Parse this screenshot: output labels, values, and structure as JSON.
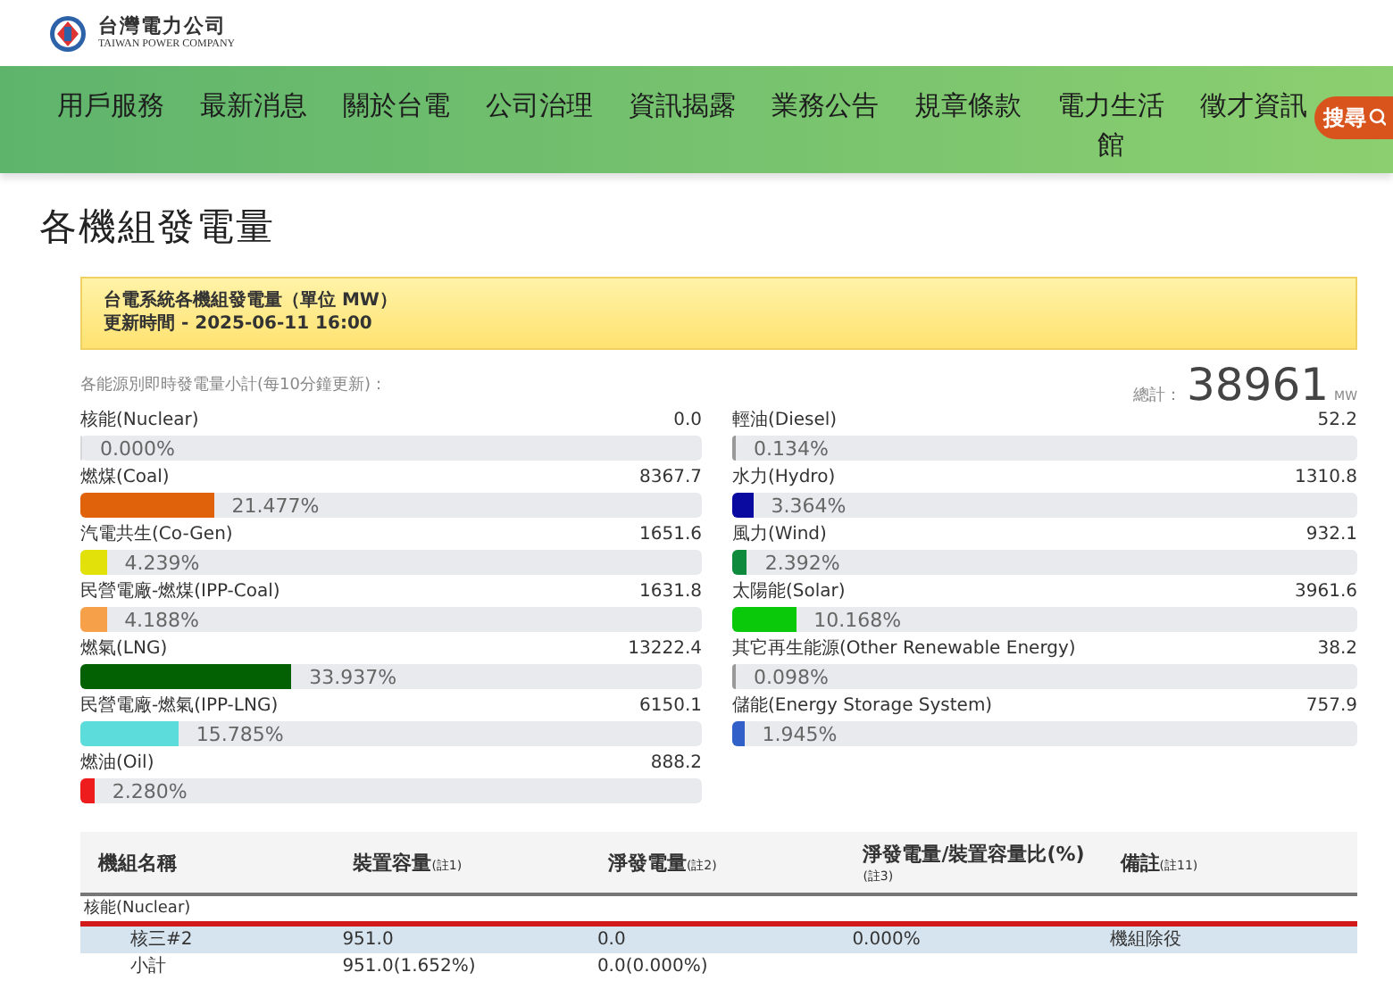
{
  "header": {
    "logo_title": "台灣電力公司",
    "logo_subtitle": "TAIWAN POWER COMPANY"
  },
  "nav": {
    "items": [
      "用戶服務",
      "最新消息",
      "關於台電",
      "公司治理",
      "資訊揭露",
      "業務公告",
      "規章條款",
      "電力生活館",
      "徵才資訊"
    ],
    "search_label": "搜尋"
  },
  "page_title": "各機組發電量",
  "notice": {
    "line1": "台電系統各機組發電量（單位 MW）",
    "line2": "更新時間 - 2025-06-11 16:00"
  },
  "summary": {
    "caption": "各能源別即時發電量小計(每10分鐘更新)：",
    "total_label": "總計：",
    "total": "38961",
    "unit": "MW"
  },
  "sources": [
    {
      "name": "核能(Nuclear)",
      "value": "0.0",
      "percent": "0.000%",
      "level": 0
    },
    {
      "name": "燃煤(Coal)",
      "value": "8367.7",
      "percent": "21.477%",
      "level": 0.21477,
      "color": "#e0620a"
    },
    {
      "name": "汽電共生(Co-Gen)",
      "value": "1651.6",
      "percent": "4.239%",
      "level": 0.04239,
      "color": "#e2e20a"
    },
    {
      "name": "民營電廠-燃煤(IPP-Coal)",
      "value": "1631.8",
      "percent": "4.188%",
      "level": 0.04188,
      "color": "#f7a04a"
    },
    {
      "name": "燃氣(LNG)",
      "value": "13222.4",
      "percent": "33.937%",
      "level": 0.33937,
      "color": "#036003"
    },
    {
      "name": "民營電廠-燃氣(IPP-LNG)",
      "value": "6150.1",
      "percent": "15.785%",
      "level": 0.15785,
      "color": "#5ddcdc"
    },
    {
      "name": "燃油(Oil)",
      "value": "888.2",
      "percent": "2.280%",
      "level": 0.0228,
      "color": "#ee1c1c"
    },
    {
      "name": "輕油(Diesel)",
      "value": "52.2",
      "percent": "0.134%",
      "level": 0.00134,
      "color": "#999999"
    },
    {
      "name": "水力(Hydro)",
      "value": "1310.8",
      "percent": "3.364%",
      "level": 0.03364,
      "color": "#0a0aa0"
    },
    {
      "name": "風力(Wind)",
      "value": "932.1",
      "percent": "2.392%",
      "level": 0.02392,
      "color": "#0d8a3c"
    },
    {
      "name": "太陽能(Solar)",
      "value": "3961.6",
      "percent": "10.168%",
      "level": 0.10168,
      "color": "#0ac80a"
    },
    {
      "name": "其它再生能源(Other Renewable Energy)",
      "value": "38.2",
      "percent": "0.098%",
      "level": 0.00098,
      "color": "#999999"
    },
    {
      "name": "儲能(Energy Storage System)",
      "value": "757.9",
      "percent": "1.945%",
      "level": 0.01945,
      "color": "#3060c8"
    }
  ],
  "table": {
    "columns": [
      "機組名稱",
      "裝置容量$_{(註1)}$",
      "淨發電量$_{(註2)}$",
      "淨發電量/裝置容量比(%)",
      "備註$_{(註11)}$"
    ],
    "column_4_note": "(註3)",
    "groups": [
      {
        "name": "核能(Nuclear)",
        "rows": [
          {
            "kind": "unit",
            "cells": [
              "核三#2",
              "951.0",
              "0.0",
              "0.000%",
              "機組除役"
            ]
          },
          {
            "kind": "subtotal",
            "cells": [
              "小計",
              "951.0(1.652%)",
              "0.0(0.000%)"
            ]
          }
        ]
      }
    ]
  }
}
